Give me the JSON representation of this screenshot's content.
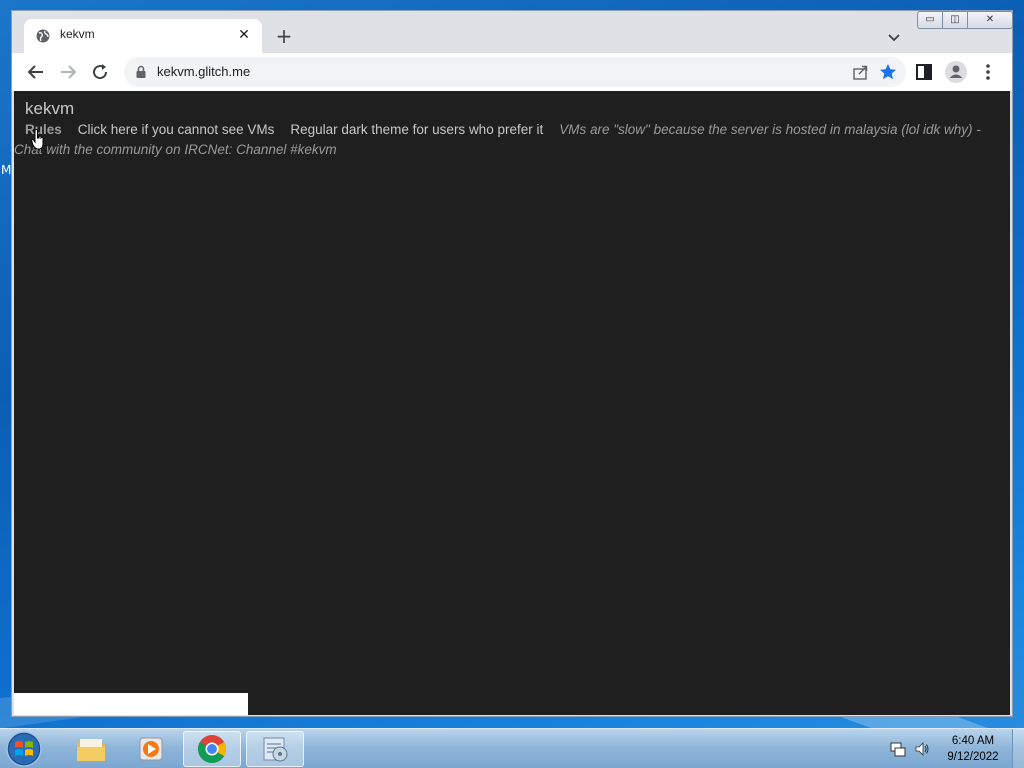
{
  "browser": {
    "tab_title": "kekvm",
    "tab_close": "✕",
    "new_tab": "+",
    "url": "kekvm.glitch.me"
  },
  "page": {
    "site_title": "kekvm",
    "nav": {
      "rules": "Rules",
      "cant_see_vms": "Click here if you cannot see VMs",
      "dark_theme": "Regular dark theme for users who prefer it",
      "notice": "VMs are \"slow\" because the server is hosted in malaysia (lol idk why) - Chat with the community on IRCNet: Channel #kekvm"
    }
  },
  "taskbar": {
    "time": "6:40 AM",
    "date": "9/12/2022",
    "apps": [
      "windows-explorer",
      "media-player",
      "google-chrome",
      "notepad-app"
    ]
  },
  "desktop": {
    "edge_letter": "M"
  },
  "colors": {
    "page_bg": "#1f1f1f",
    "page_text": "#c8c8c8",
    "star_blue": "#1a73e8"
  }
}
